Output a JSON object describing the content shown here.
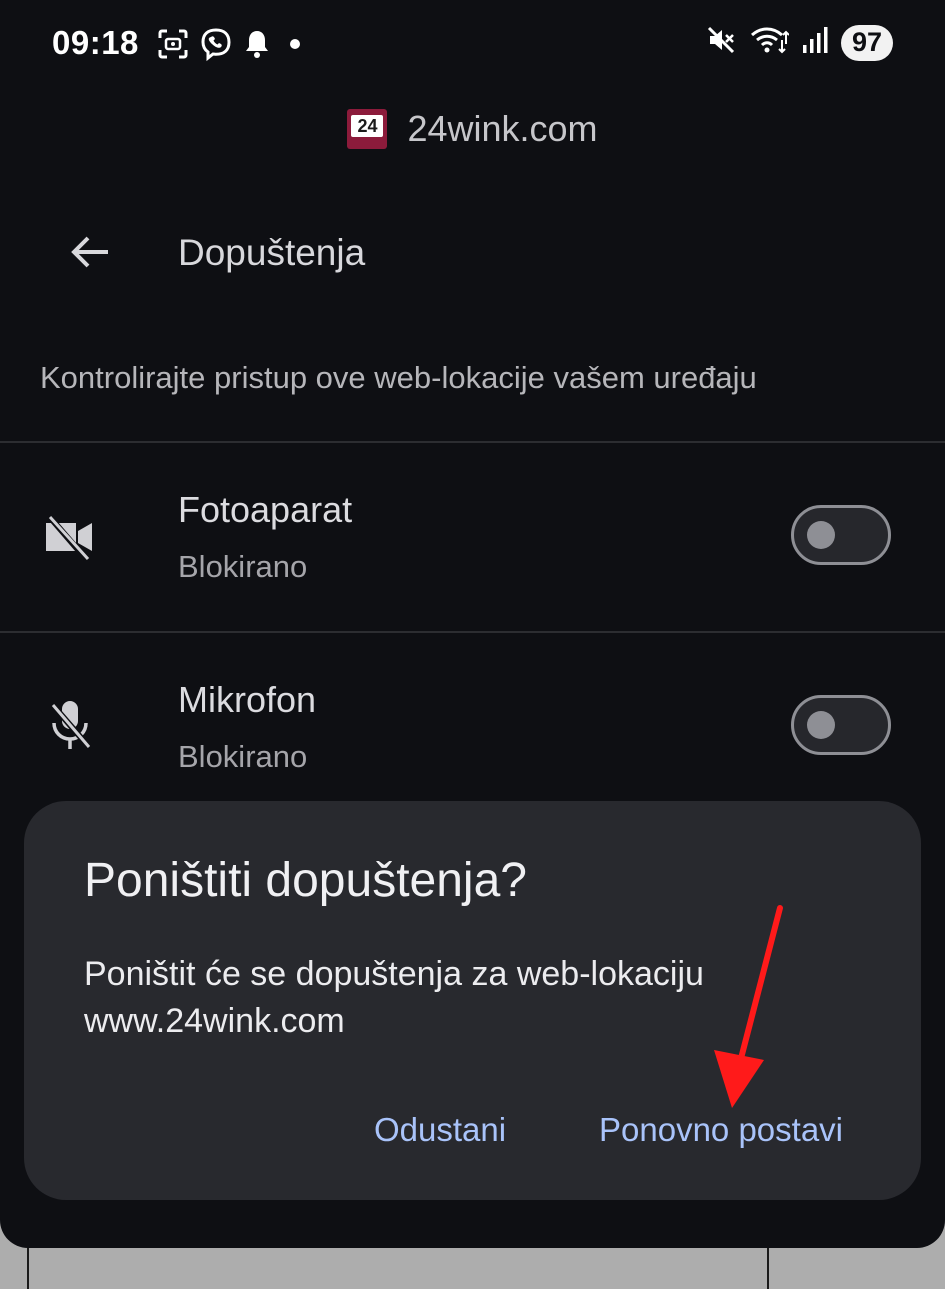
{
  "status_bar": {
    "time": "09:18",
    "battery": "97",
    "left_icons": [
      "screenshot-icon",
      "viber-icon",
      "notification-bell-icon",
      "notification-dot-icon"
    ],
    "right_icons": [
      "mute-icon",
      "wifi-icon",
      "signal-icon",
      "battery-icon"
    ]
  },
  "site": {
    "logo_text": "24",
    "domain": "24wink.com",
    "logo_color": "#8c1b3b"
  },
  "toolbar": {
    "back_icon": "arrow-back-icon",
    "title": "Dopuštenja"
  },
  "description": "Kontrolirajte pristup ove web-lokacije vašem uređaju",
  "permissions": [
    {
      "name": "Fotoaparat",
      "status": "Blokirano",
      "icon": "camera-off-icon",
      "enabled": false
    },
    {
      "name": "Mikrofon",
      "status": "Blokirano",
      "icon": "mic-off-icon",
      "enabled": false
    }
  ],
  "dialog": {
    "title": "Poništiti dopuštenja?",
    "body_line1": "Poništit će se dopuštenja za web-lokaciju",
    "body_line2": "www.24wink.com",
    "cancel_label": "Odustani",
    "reset_label": "Ponovno postavi",
    "accent_color": "#a9c3fa"
  },
  "annotation": {
    "arrow_color": "#ff1a1a"
  }
}
